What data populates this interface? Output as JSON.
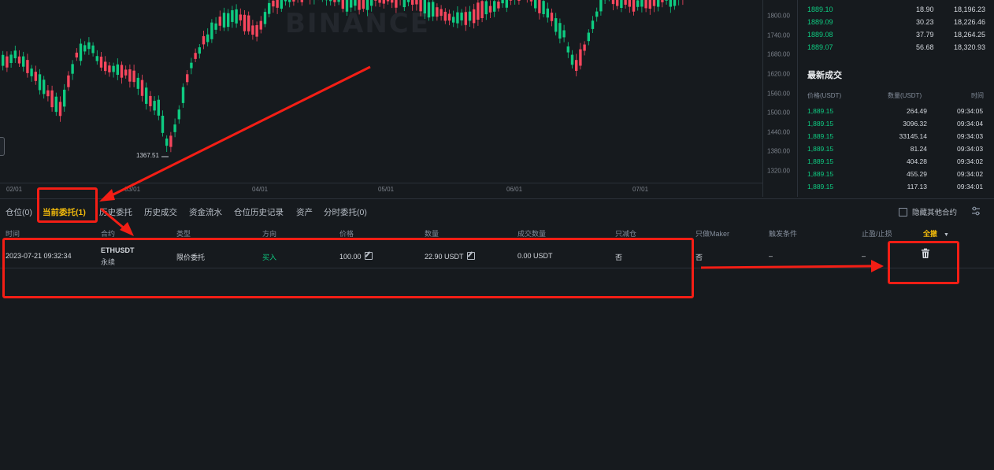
{
  "chart": {
    "watermark": "BINANCE",
    "low_label": "1367.51",
    "y_ticks": [
      {
        "label": "1800.00",
        "v": 1800
      },
      {
        "label": "1740.00",
        "v": 1740
      },
      {
        "label": "1680.00",
        "v": 1680
      },
      {
        "label": "1620.00",
        "v": 1620
      },
      {
        "label": "1560.00",
        "v": 1560
      },
      {
        "label": "1500.00",
        "v": 1500
      },
      {
        "label": "1440.00",
        "v": 1440
      },
      {
        "label": "1380.00",
        "v": 1380
      },
      {
        "label": "1320.00",
        "v": 1320
      }
    ],
    "x_ticks": [
      "02/01",
      "03/01",
      "04/01",
      "05/01",
      "06/01",
      "07/01"
    ],
    "colors": {
      "up": "#0ecb81",
      "down": "#f6465d"
    }
  },
  "orderbook": {
    "rows": [
      {
        "price": "1889.10",
        "qty": "18.90",
        "total": "18,196.23"
      },
      {
        "price": "1889.09",
        "qty": "30.23",
        "total": "18,226.46"
      },
      {
        "price": "1889.08",
        "qty": "37.79",
        "total": "18,264.25"
      },
      {
        "price": "1889.07",
        "qty": "56.68",
        "total": "18,320.93"
      }
    ]
  },
  "trades": {
    "title": "最新成交",
    "headers": {
      "price": "价格(USDT)",
      "qty": "数量(USDT)",
      "time": "时间"
    },
    "rows": [
      {
        "price": "1,889.15",
        "qty": "264.49",
        "time": "09:34:05"
      },
      {
        "price": "1,889.15",
        "qty": "3096.32",
        "time": "09:34:04"
      },
      {
        "price": "1,889.15",
        "qty": "33145.14",
        "time": "09:34:03"
      },
      {
        "price": "1,889.15",
        "qty": "81.24",
        "time": "09:34:03"
      },
      {
        "price": "1,889.15",
        "qty": "404.28",
        "time": "09:34:02"
      },
      {
        "price": "1,889.15",
        "qty": "455.29",
        "time": "09:34:02"
      },
      {
        "price": "1,889.15",
        "qty": "117.13",
        "time": "09:34:01"
      }
    ]
  },
  "tabs": {
    "positions": "仓位(0)",
    "open_orders": "当前委托(1)",
    "order_history": "历史委托",
    "trade_history": "历史成交",
    "transactions": "资金流水",
    "position_history": "仓位历史记录",
    "assets": "资产",
    "time_orders": "分时委托(0)",
    "hide_other": "隐藏其他合约"
  },
  "table": {
    "headers": {
      "time": "时间",
      "contract": "合约",
      "type": "类型",
      "side": "方向",
      "price": "价格",
      "amount": "数量",
      "filled": "成交数量",
      "reduce_only": "只减仓",
      "post_only": "只做Maker",
      "trigger": "触发条件",
      "tpsl": "止盈/止损",
      "cancel_all": "全撤"
    },
    "row": {
      "time": "2023-07-21 09:32:34",
      "symbol": "ETHUSDT",
      "contract_type": "永续",
      "type": "限价委托",
      "side": "买入",
      "price": "100.00",
      "amount": "22.90 USDT",
      "filled": "0.00 USDT",
      "reduce_only": "否",
      "post_only": "否",
      "trigger": "–",
      "tpsl": "–"
    }
  },
  "annotation_color": "#f41e15"
}
